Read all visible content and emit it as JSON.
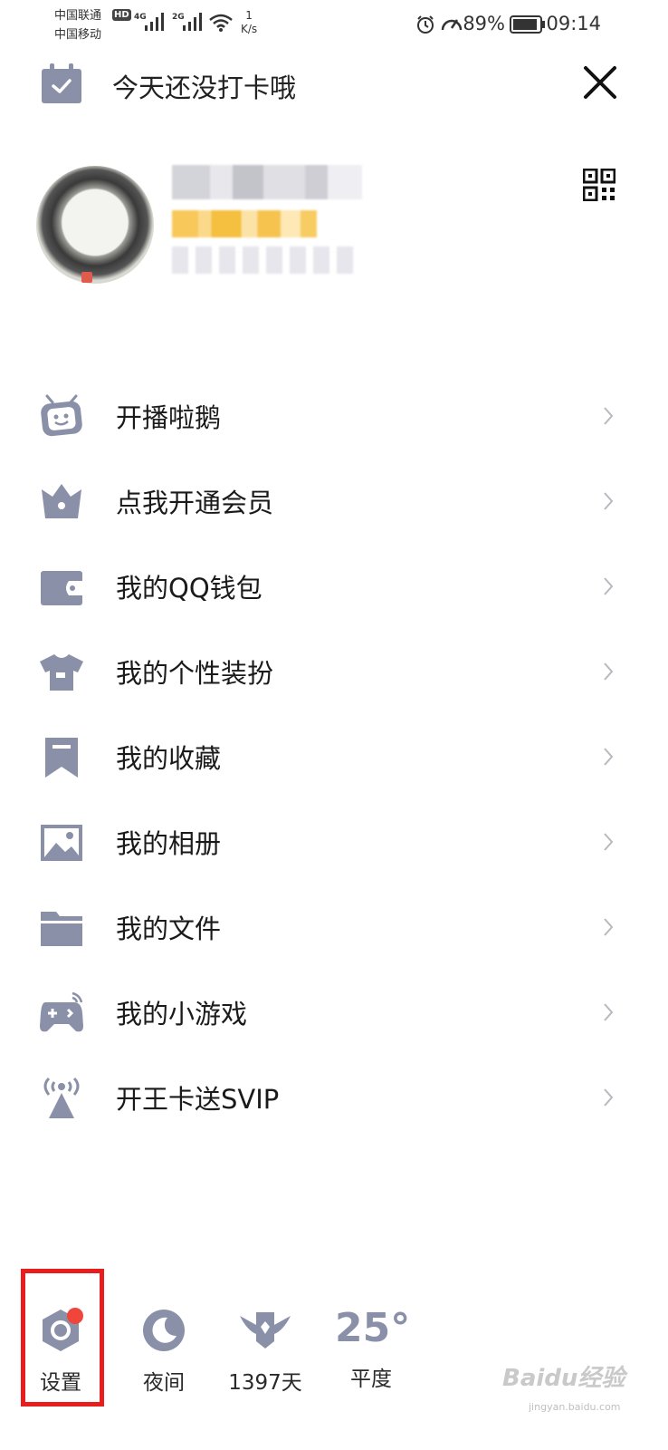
{
  "status_bar": {
    "carrier1": "中国联通",
    "carrier2": "中国移动",
    "hd": "HD",
    "sig1": "4G",
    "sig2": "2G",
    "net_rate": "1",
    "net_unit": "K/s",
    "battery": "89%",
    "time": "09:14"
  },
  "header": {
    "title": "今天还没打卡哦"
  },
  "menu": {
    "items": [
      {
        "label": "开播啦鹅",
        "icon": "tv-robot-icon"
      },
      {
        "label": "点我开通会员",
        "icon": "crown-icon"
      },
      {
        "label": "我的QQ钱包",
        "icon": "wallet-icon"
      },
      {
        "label": "我的个性装扮",
        "icon": "shirt-icon"
      },
      {
        "label": "我的收藏",
        "icon": "bookmark-icon"
      },
      {
        "label": "我的相册",
        "icon": "image-icon"
      },
      {
        "label": "我的文件",
        "icon": "folder-icon"
      },
      {
        "label": "我的小游戏",
        "icon": "gamepad-icon"
      },
      {
        "label": "开王卡送SVIP",
        "icon": "signal-tower-icon"
      }
    ]
  },
  "bottom_bar": {
    "settings": "设置",
    "night": "夜间",
    "days": "1397天",
    "weather_temp": "25°",
    "weather_label": "平度"
  },
  "watermark": {
    "text": "Baidu经验",
    "sub": "jingyan.baidu.com"
  },
  "colors": {
    "icon_gray": "#8a90a8",
    "highlight_red": "#e81d1d",
    "badge_red": "#f0453a"
  }
}
